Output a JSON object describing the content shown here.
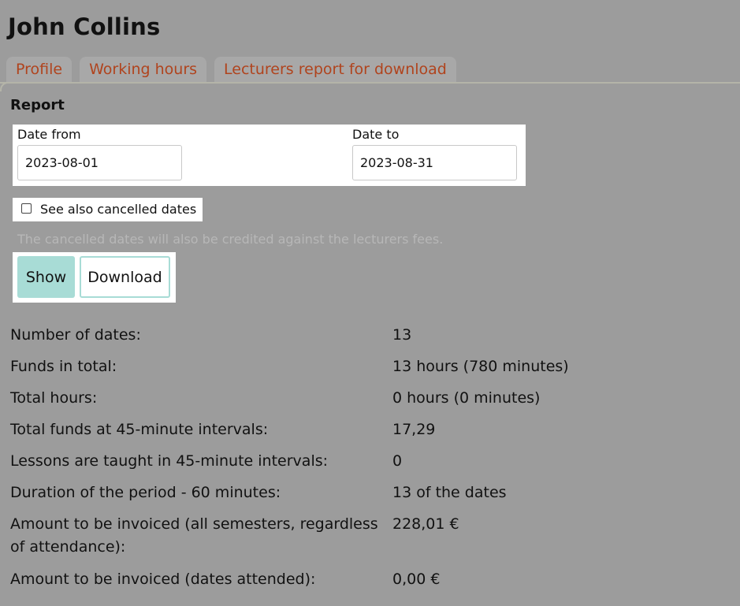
{
  "header": {
    "title": "John Collins"
  },
  "tabs": [
    {
      "label": "Profile"
    },
    {
      "label": "Working hours"
    },
    {
      "label": "Lecturers report for download"
    }
  ],
  "report": {
    "title": "Report",
    "date_from": {
      "label": "Date from",
      "value": "2023-08-01"
    },
    "date_to": {
      "label": "Date to",
      "value": "2023-08-31"
    },
    "cancelled_checkbox": {
      "label": "See also cancelled dates",
      "checked": false
    },
    "hint": "The cancelled dates will also be credited against the lecturers fees.",
    "show_label": "Show",
    "download_label": "Download"
  },
  "summary": [
    {
      "label": "Number of dates:",
      "value": "13"
    },
    {
      "label": "Funds in total:",
      "value": "13 hours (780 minutes)"
    },
    {
      "label": "Total hours:",
      "value": "0 hours (0 minutes)"
    },
    {
      "label": "Total funds at 45-minute intervals:",
      "value": "17,29"
    },
    {
      "label": "Lessons are taught in 45-minute intervals:",
      "value": "0"
    },
    {
      "label": "Duration of the period - 60 minutes:",
      "value": "13 of the dates"
    },
    {
      "label": "Amount to be invoiced (all semesters, regardless of attendance):",
      "value": "228,01 €"
    },
    {
      "label": "Amount to be invoiced (dates attended):",
      "value": "0,00 €"
    }
  ],
  "colors": {
    "page_background": "#9c9c9c",
    "tab_text": "#b0441e",
    "button_accent": "#a8dcd6",
    "hint_text": "#b7b7b7"
  }
}
